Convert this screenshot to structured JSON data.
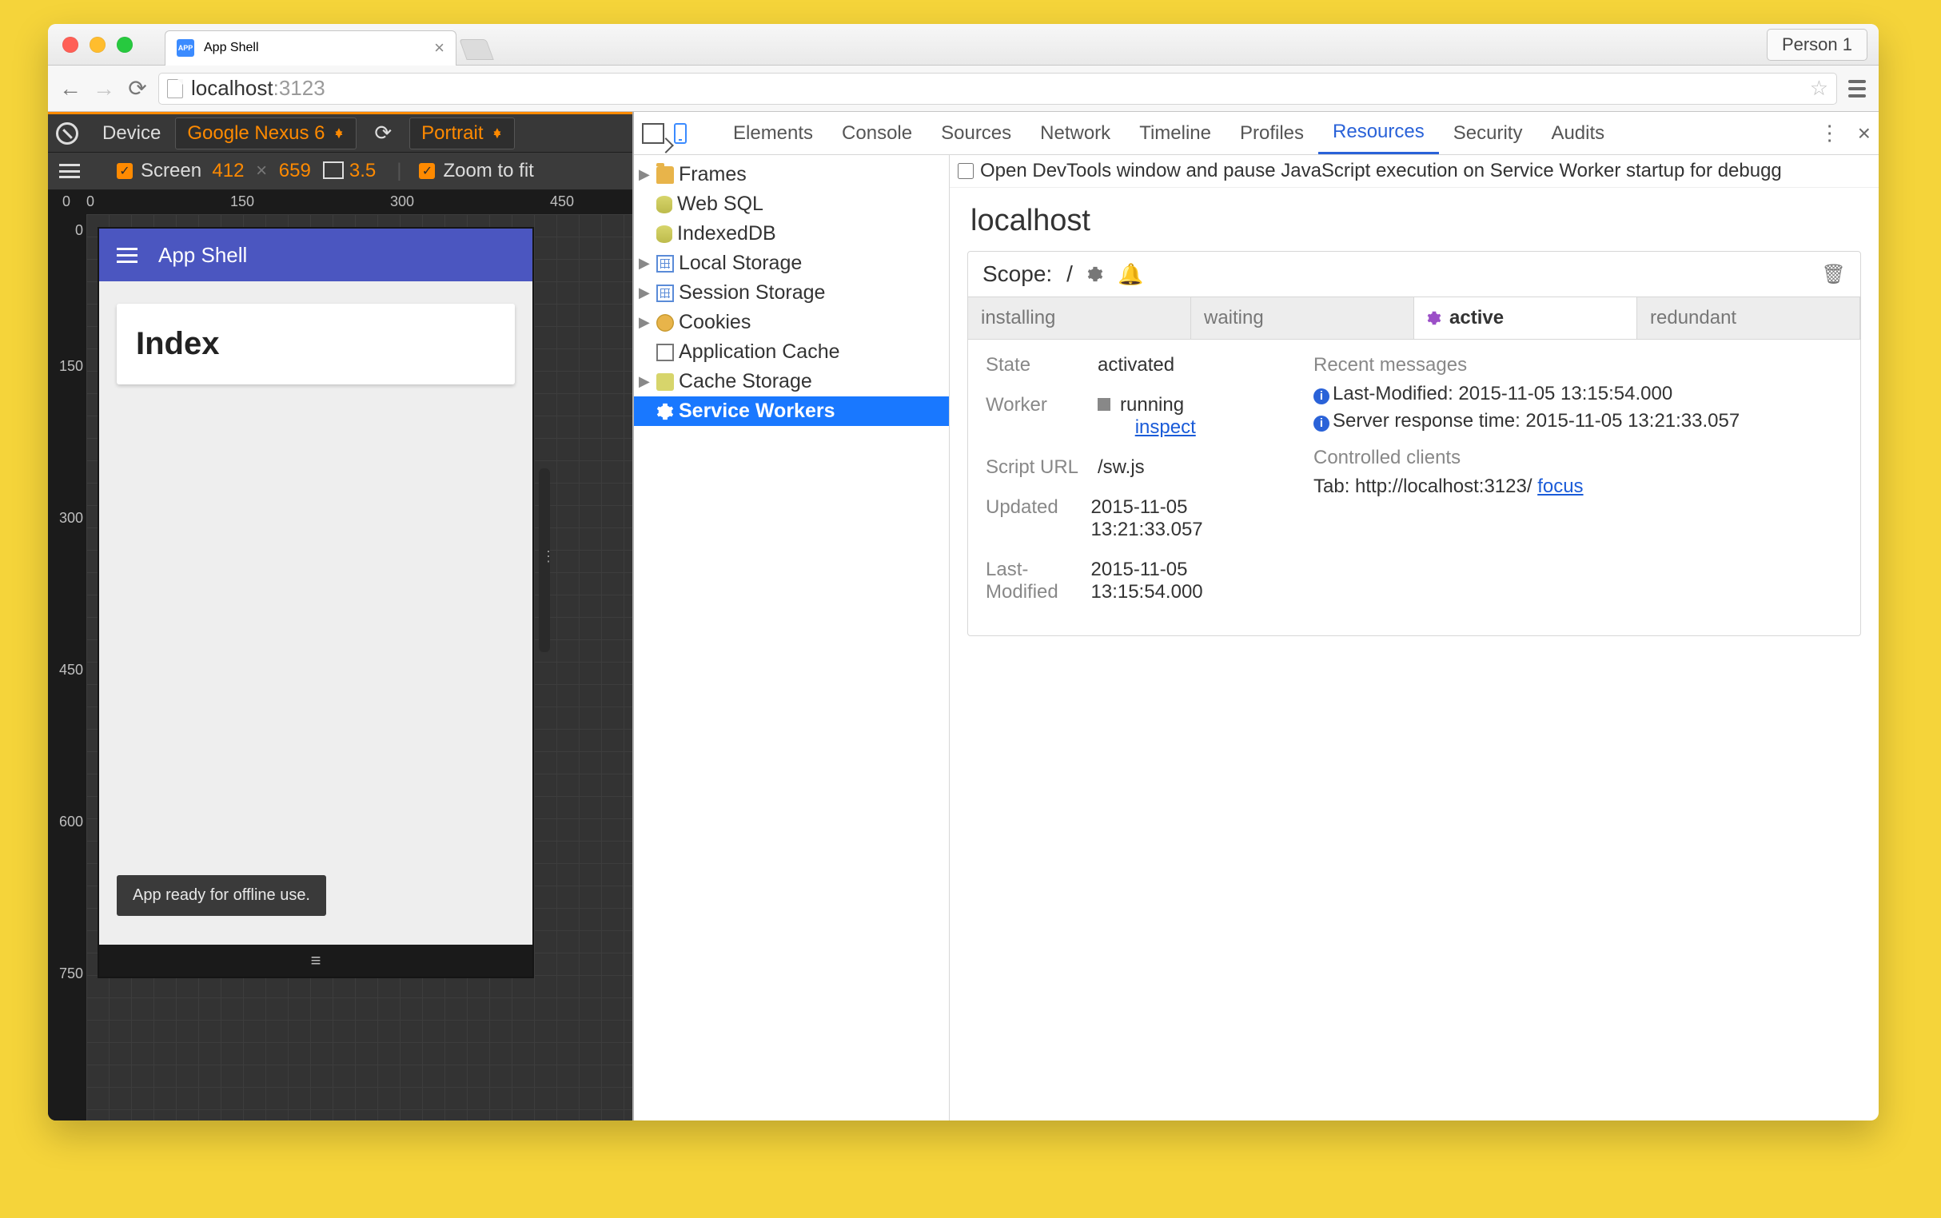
{
  "browser": {
    "tab_title": "App Shell",
    "person": "Person 1",
    "url_host": "localhost",
    "url_port": ":3123"
  },
  "device_toolbar": {
    "device_label": "Device",
    "device_value": "Google Nexus 6",
    "orientation": "Portrait",
    "screen_label": "Screen",
    "screen_w": "412",
    "screen_h": "659",
    "dpr": "3.5",
    "zoom_label": "Zoom to fit",
    "ruler_h": {
      "n0": "0",
      "n150": "150",
      "n300": "300",
      "n450": "450"
    },
    "ruler_v": {
      "n0": "0",
      "n150": "150",
      "n300": "300",
      "n450": "450",
      "n600": "600",
      "n750": "750"
    }
  },
  "phone": {
    "app_title": "App Shell",
    "card_title": "Index",
    "toast": "App ready for offline use."
  },
  "devtools": {
    "tabs": {
      "elements": "Elements",
      "console": "Console",
      "sources": "Sources",
      "network": "Network",
      "timeline": "Timeline",
      "profiles": "Profiles",
      "resources": "Resources",
      "security": "Security",
      "audits": "Audits"
    },
    "tree": {
      "frames": "Frames",
      "websql": "Web SQL",
      "indexeddb": "IndexedDB",
      "local_storage": "Local Storage",
      "session_storage": "Session Storage",
      "cookies": "Cookies",
      "app_cache": "Application Cache",
      "cache_storage": "Cache Storage",
      "service_workers": "Service Workers"
    },
    "pause_msg": "Open DevTools window and pause JavaScript execution on Service Worker startup for debugg",
    "host": "localhost",
    "scope_label": "Scope:",
    "scope_value": "/",
    "state_tabs": {
      "installing": "installing",
      "waiting": "waiting",
      "active": "active",
      "redundant": "redundant"
    },
    "details": {
      "state_label": "State",
      "state_value": "activated",
      "worker_label": "Worker",
      "worker_status": "running",
      "worker_inspect": "inspect",
      "script_label": "Script URL",
      "script_value": "/sw.js",
      "updated_label": "Updated",
      "updated_value": "2015-11-05 13:21:33.057",
      "lastmod_label": "Last-Modified",
      "lastmod_value": "2015-11-05 13:15:54.000",
      "recent_label": "Recent messages",
      "msg1": "Last-Modified: 2015-11-05 13:15:54.000",
      "msg2": "Server response time: 2015-11-05 13:21:33.057",
      "clients_label": "Controlled clients",
      "client_prefix": "Tab: http://localhost:3123/ ",
      "client_focus": "focus"
    }
  }
}
